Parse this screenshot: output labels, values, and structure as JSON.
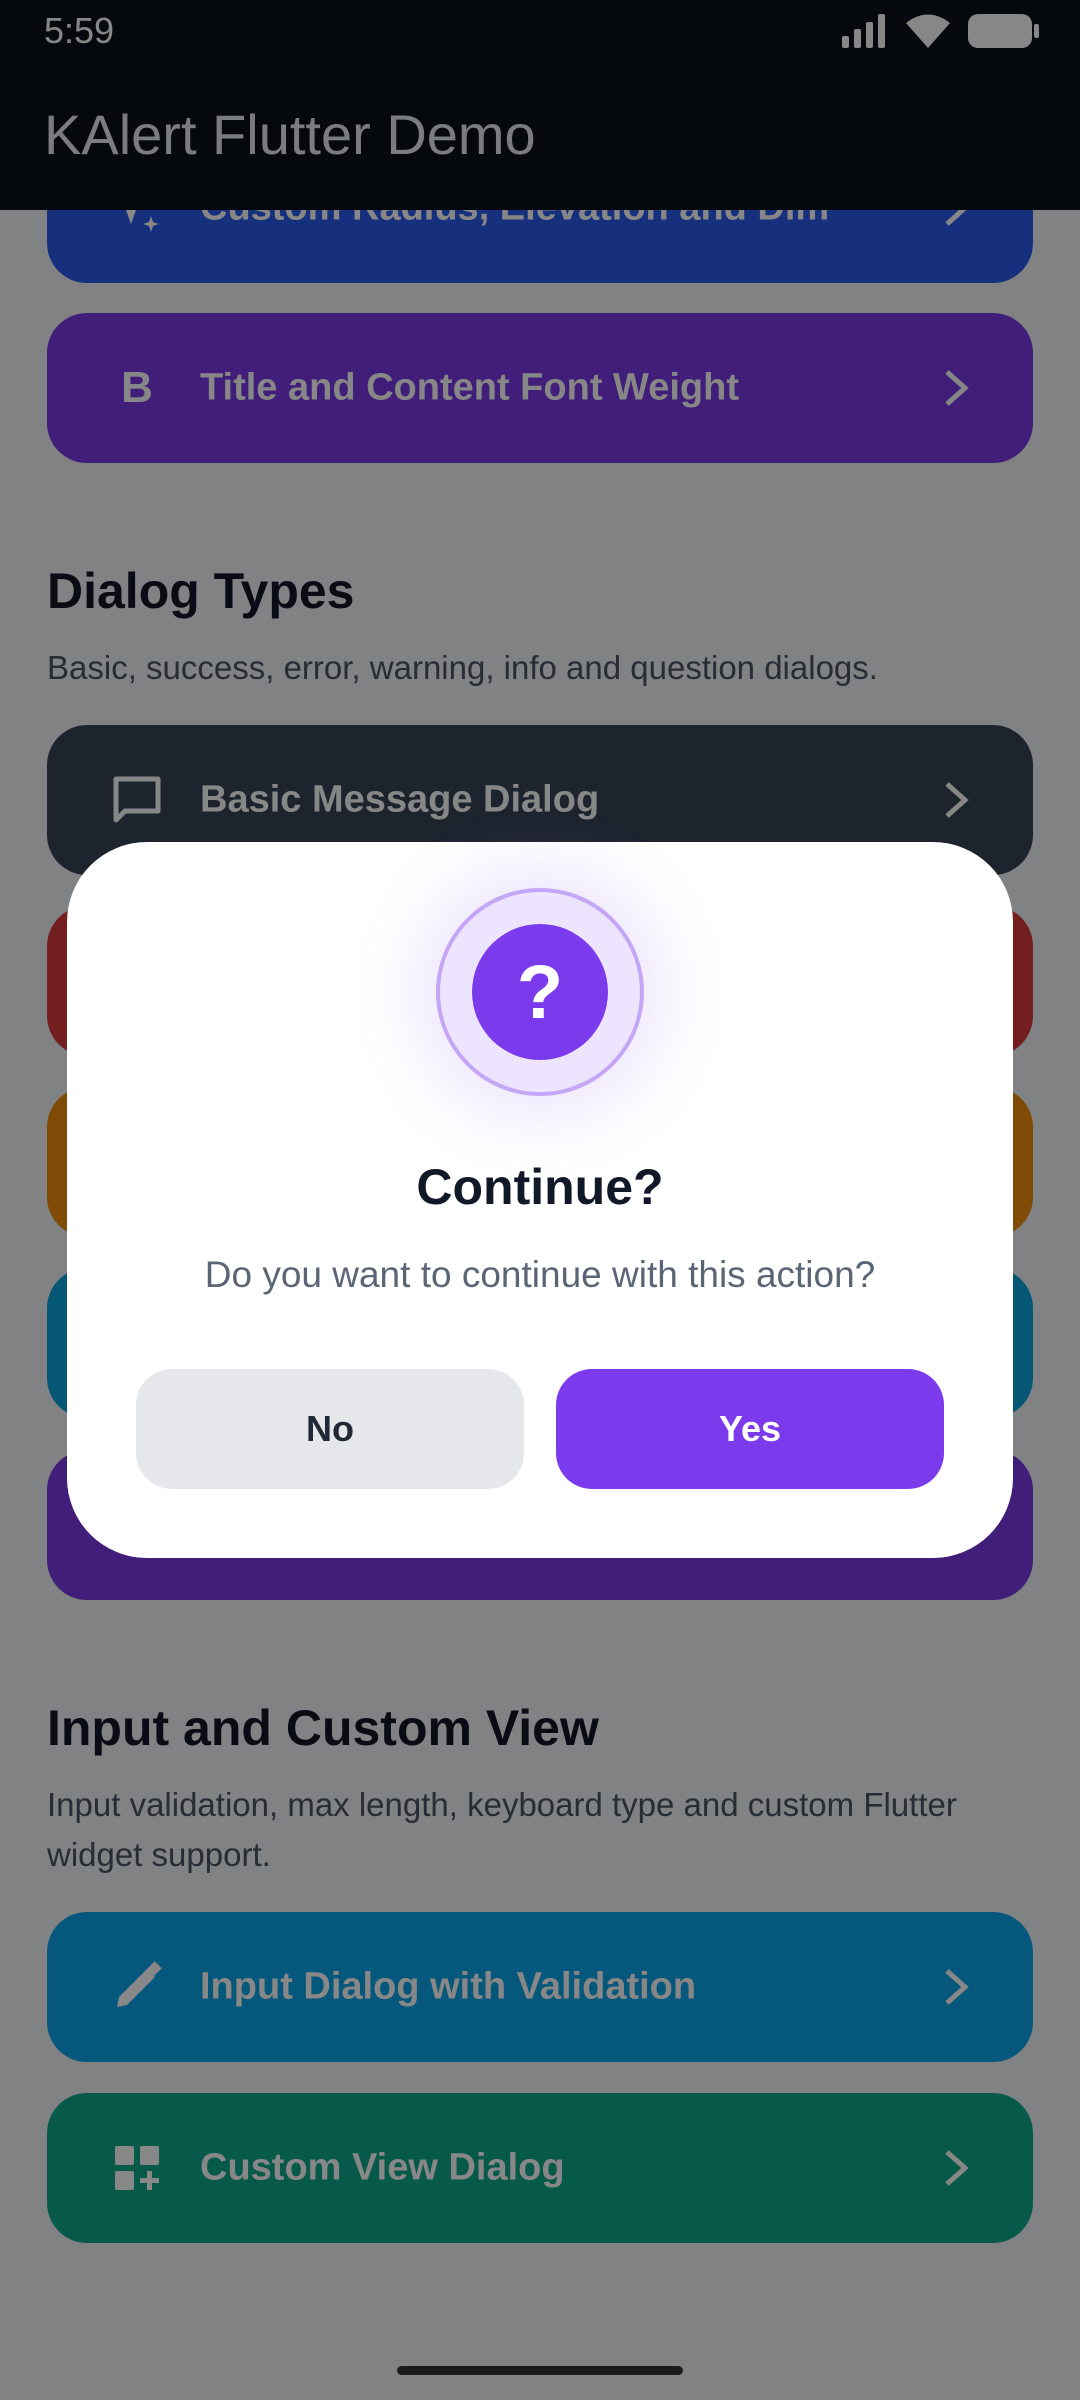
{
  "status_bar": {
    "time": "5:59"
  },
  "app_bar": {
    "title": "KAlert Flutter Demo"
  },
  "top_buttons": [
    {
      "label": "Custom Radius, Elevation and Dim",
      "color": "#2a5bef",
      "icon": "sparkle-icon"
    },
    {
      "label": "Title and Content Font Weight",
      "color": "#7b3ae6",
      "icon": "bold-b-icon",
      "icon_text": "B"
    }
  ],
  "dialog_types": {
    "title": "Dialog Types",
    "subtitle": "Basic, success, error, warning, info and question dialogs.",
    "buttons": [
      {
        "label": "Basic Message Dialog",
        "color": "#394457",
        "icon": "chat-bubble-icon"
      },
      {
        "label": "",
        "color": "#dc3b3b"
      },
      {
        "label": "",
        "color": "#f08f0f"
      },
      {
        "label": "",
        "color": "#0ba5de"
      },
      {
        "label": "",
        "color": "#7b3ae6"
      }
    ]
  },
  "input_section": {
    "title": "Input and Custom View",
    "subtitle": "Input validation, max length, keyboard type and custom Flutter widget support.",
    "buttons": [
      {
        "label": "Input Dialog with Validation",
        "color": "#0ba5e9",
        "icon": "pencil-icon"
      },
      {
        "label": "Custom View Dialog",
        "color": "#0fa98b",
        "icon": "dashboard-add-icon"
      }
    ]
  },
  "dialog": {
    "icon_text": "?",
    "title": "Continue?",
    "message": "Do you want to continue with this action?",
    "no_label": "No",
    "yes_label": "Yes",
    "accent": "#7c3aed"
  }
}
